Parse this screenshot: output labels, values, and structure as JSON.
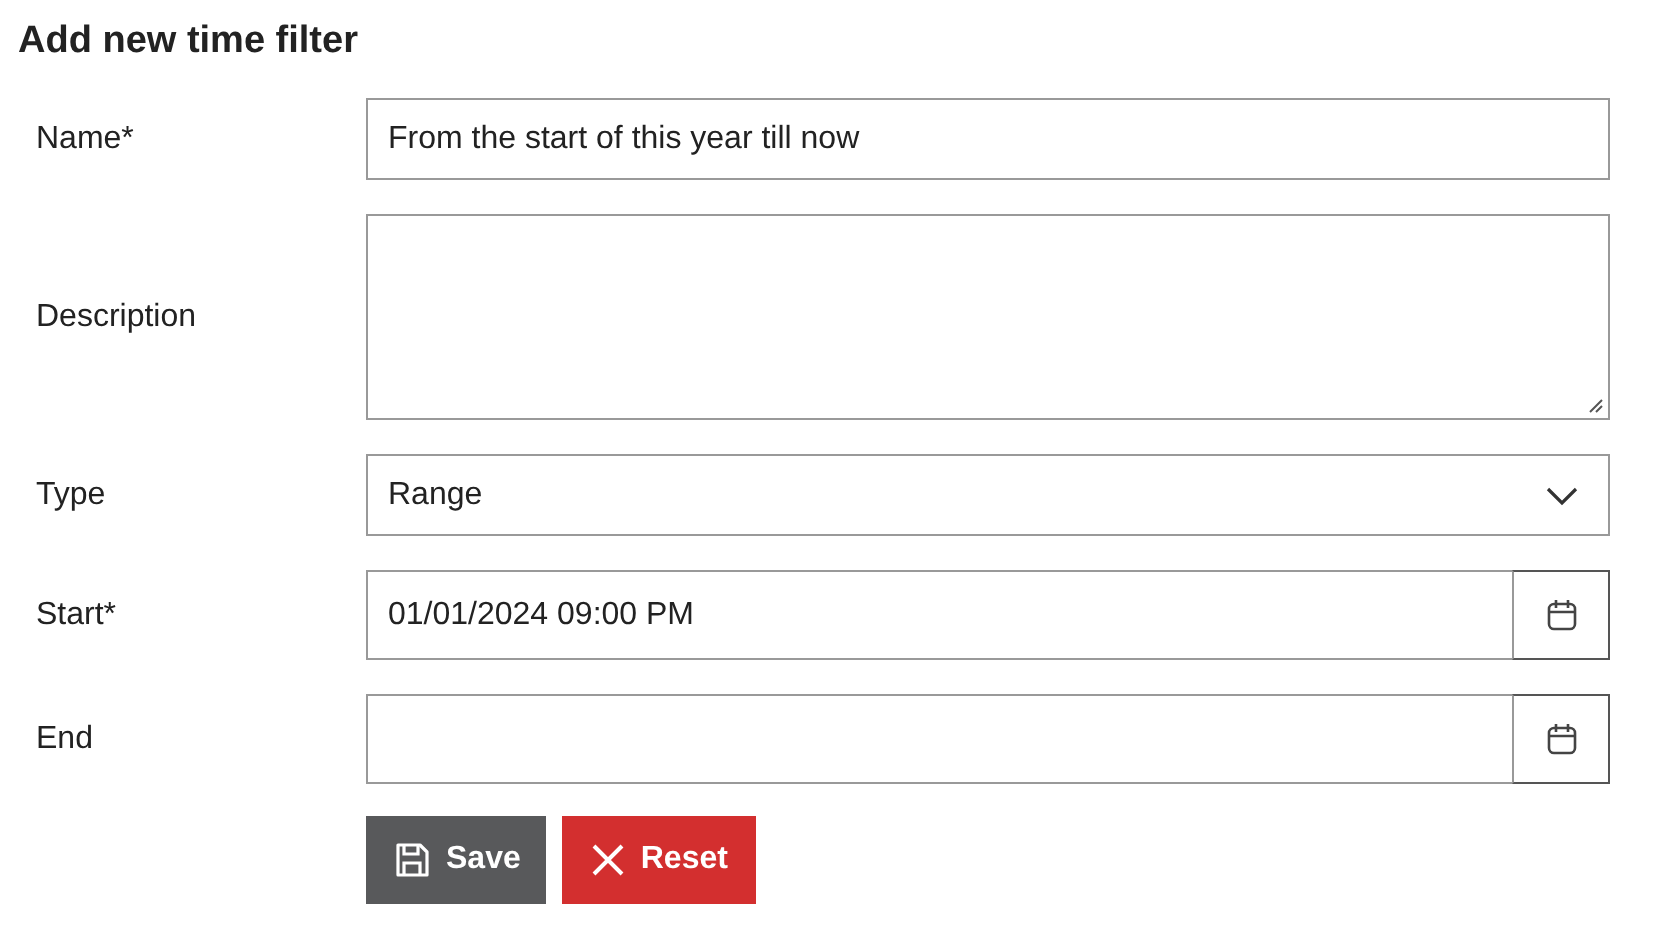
{
  "title": "Add new time filter",
  "fields": [
    {
      "kind": "text",
      "label": "Name*",
      "value": "From the start of this year till now"
    },
    {
      "kind": "textarea",
      "label": "Description"
    },
    {
      "kind": "select",
      "label": "Type",
      "value": "Range"
    },
    {
      "kind": "date",
      "label": "Start*",
      "value": "01/01/2024 09:00 PM"
    },
    {
      "kind": "date",
      "label": "End"
    }
  ],
  "buttons": [
    {
      "kind": "save",
      "label": "Save"
    },
    {
      "kind": "reset",
      "label": "Reset"
    }
  ]
}
